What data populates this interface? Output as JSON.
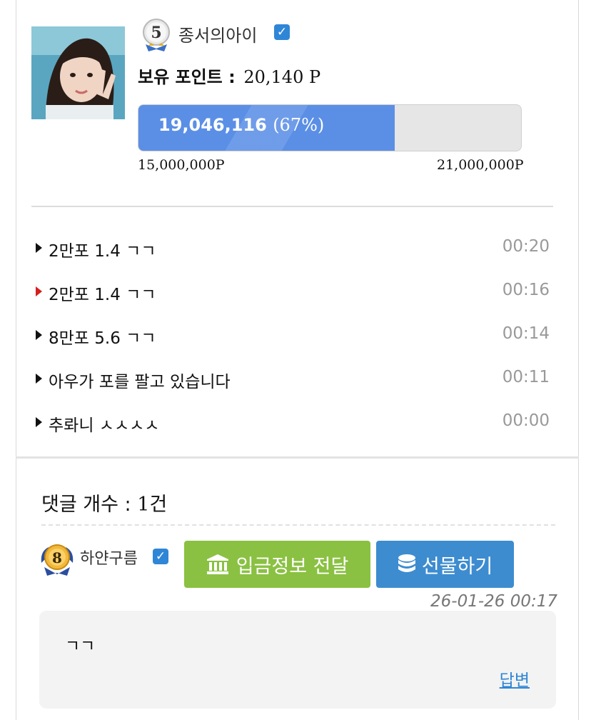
{
  "profile": {
    "level": "5",
    "username": "종서의아이",
    "points_label": "보유 포인트 :",
    "points_value": "20,140 P",
    "progress": {
      "current": "19,046,116",
      "percent_text": "(67%)",
      "fraction": 0.67,
      "min_label": "15,000,000P",
      "max_label": "21,000,000P"
    }
  },
  "feed": {
    "items": [
      {
        "text": "2만포 1.4 ㄱㄱ",
        "time": "00:20",
        "arrow_color": "#111111"
      },
      {
        "text": "2만포 1.4 ㄱㄱ",
        "time": "00:16",
        "arrow_color": "#d42020"
      },
      {
        "text": "8만포 5.6 ㄱㄱ",
        "time": "00:14",
        "arrow_color": "#111111"
      },
      {
        "text": "아우가 포를 팔고 있습니다",
        "time": "00:11",
        "arrow_color": "#111111"
      },
      {
        "text": "추롸니 ㅅㅅㅅㅅ",
        "time": "00:00",
        "arrow_color": "#111111"
      }
    ]
  },
  "comments": {
    "count_label": "댓글 개수 :",
    "count_value": "1건",
    "list": [
      {
        "level": "8",
        "username": "하얀구름",
        "deposit_button": "입금정보 전달",
        "gift_button": "선물하기",
        "date": "26-01-26 00:17",
        "text": "ㄱㄱ",
        "reply_label": "답변"
      }
    ]
  },
  "icons": {
    "verified": "check-icon",
    "deposit": "bank-icon",
    "gift": "coins-icon",
    "arrow": "triangle-right-icon"
  },
  "colors": {
    "progress_fill": "#5b8fe6",
    "verified": "#2f86d6",
    "deposit_button": "#8ac142",
    "gift_button": "#3d8cd0",
    "reply_link": "#2f86d6"
  }
}
